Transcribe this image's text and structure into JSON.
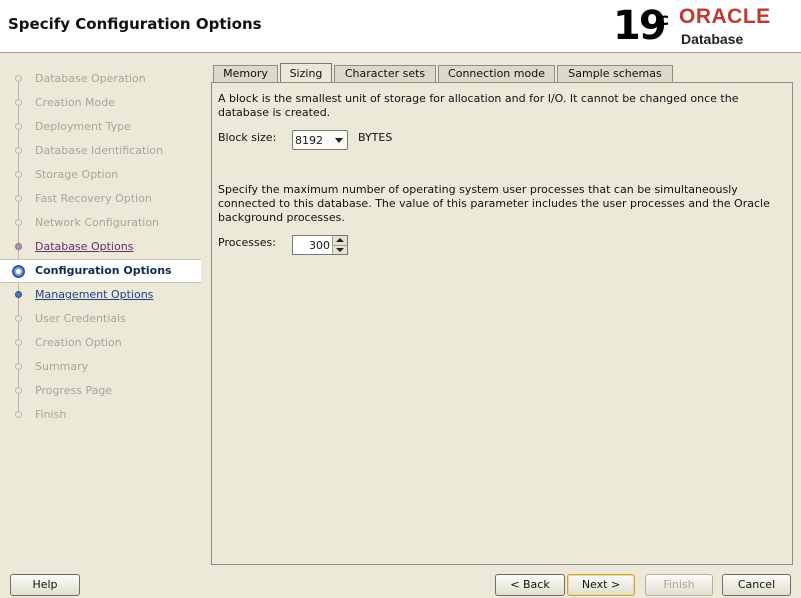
{
  "header": {
    "title": "Specify Configuration Options",
    "logo": {
      "version_number": "19",
      "version_suffix": "c",
      "brand": "ORACLE",
      "product": "Database"
    }
  },
  "steps": [
    {
      "label": "Database Operation",
      "state": "disabled"
    },
    {
      "label": "Creation Mode",
      "state": "disabled"
    },
    {
      "label": "Deployment Type",
      "state": "disabled"
    },
    {
      "label": "Database Identification",
      "state": "disabled"
    },
    {
      "label": "Storage Option",
      "state": "disabled"
    },
    {
      "label": "Fast Recovery Option",
      "state": "disabled"
    },
    {
      "label": "Network Configuration",
      "state": "disabled"
    },
    {
      "label": "Database Options",
      "state": "visited"
    },
    {
      "label": "Configuration Options",
      "state": "current"
    },
    {
      "label": "Management Options",
      "state": "next"
    },
    {
      "label": "User Credentials",
      "state": "disabled"
    },
    {
      "label": "Creation Option",
      "state": "disabled"
    },
    {
      "label": "Summary",
      "state": "disabled"
    },
    {
      "label": "Progress Page",
      "state": "disabled"
    },
    {
      "label": "Finish",
      "state": "disabled"
    }
  ],
  "tabs": [
    {
      "label": "Memory",
      "active": false
    },
    {
      "label": "Sizing",
      "active": true
    },
    {
      "label": "Character sets",
      "active": false
    },
    {
      "label": "Connection mode",
      "active": false
    },
    {
      "label": "Sample schemas",
      "active": false
    }
  ],
  "sizing": {
    "block_desc": "A block is the smallest unit of storage for allocation and for I/O. It cannot be changed once the database is created.",
    "block_size_label": "Block size:",
    "block_size_value": "8192",
    "block_size_unit": "BYTES",
    "processes_desc": "Specify the maximum number of operating system user processes that can be simultaneously connected to this database. The value of this parameter includes the user processes and the Oracle background processes.",
    "processes_label": "Processes:",
    "processes_value": "300"
  },
  "buttons": {
    "help": "Help",
    "back": "< Back",
    "next": "Next >",
    "finish": "Finish",
    "cancel": "Cancel"
  },
  "colors": {
    "window_bg": "#ece9d8",
    "oracle_red": "#c0392b",
    "current_step_text": "#0d2a5e",
    "visited_step_text": "#6b2a6b",
    "next_step_text": "#1f3f8c"
  }
}
